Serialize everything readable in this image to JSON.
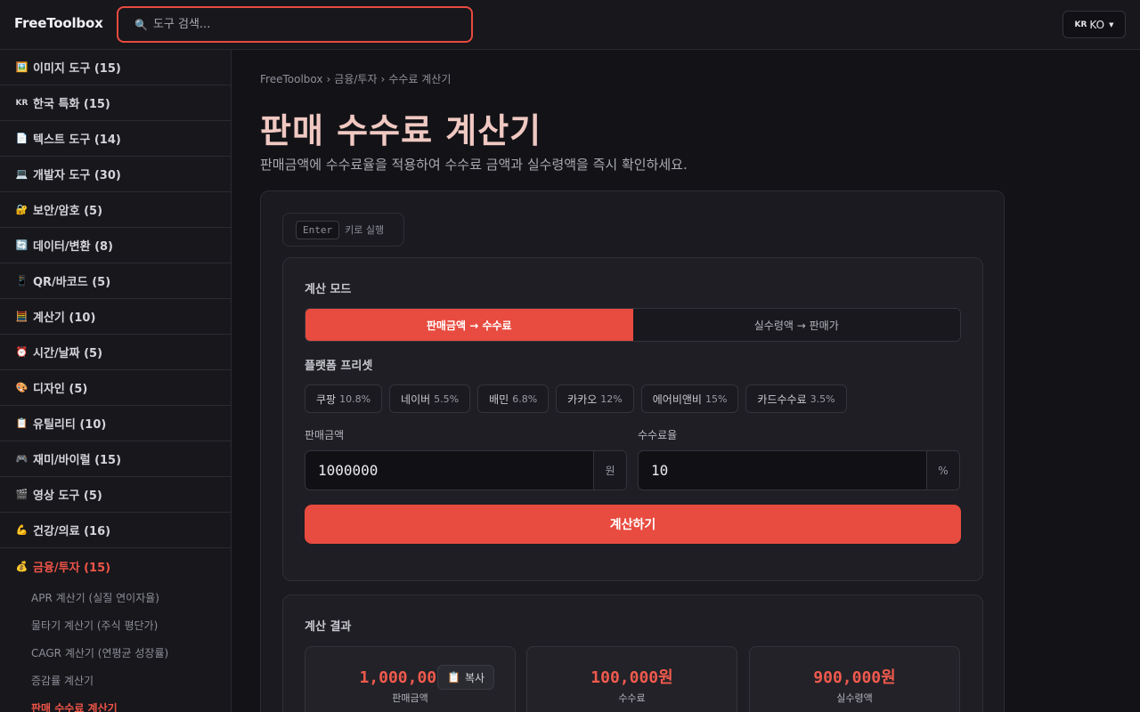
{
  "header": {
    "logo": "FreeToolbox",
    "search_placeholder": "도구 검색...",
    "lang_flag": "KR",
    "lang_label": "KO"
  },
  "sidebar": {
    "categories": [
      {
        "icon": "🖼️",
        "label": "이미지 도구 (15)"
      },
      {
        "icon": "KR",
        "label": "한국 특화 (15)"
      },
      {
        "icon": "📄",
        "label": "텍스트 도구 (14)"
      },
      {
        "icon": "💻",
        "label": "개발자 도구 (30)"
      },
      {
        "icon": "🔐",
        "label": "보안/암호 (5)"
      },
      {
        "icon": "🔄",
        "label": "데이터/변환 (8)"
      },
      {
        "icon": "📱",
        "label": "QR/바코드 (5)"
      },
      {
        "icon": "🧮",
        "label": "계산기 (10)"
      },
      {
        "icon": "⏰",
        "label": "시간/날짜 (5)"
      },
      {
        "icon": "🎨",
        "label": "디자인 (5)"
      },
      {
        "icon": "📋",
        "label": "유틸리티 (10)"
      },
      {
        "icon": "🎮",
        "label": "재미/바이럴 (15)"
      },
      {
        "icon": "🎬",
        "label": "영상 도구 (5)"
      },
      {
        "icon": "💪",
        "label": "건강/의료 (16)"
      },
      {
        "icon": "💰",
        "label": "금융/투자 (15)"
      }
    ],
    "subitems": [
      "APR 계산기 (실질 연이자율)",
      "물타기 계산기 (주식 평단가)",
      "CAGR 계산기 (연평균 성장률)",
      "증감률 계산기",
      "판매 수수료 계산기"
    ]
  },
  "main": {
    "breadcrumb": [
      "FreeToolbox",
      "금융/투자",
      "수수료 계산기"
    ],
    "breadcrumb_sep": "›",
    "title": "판매 수수료 계산기",
    "description": "판매금액에 수수료율을 적용하여 수수료 금액과 실수령액을 즉시 확인하세요.",
    "enter_key": "Enter",
    "enter_hint": "키로 실행",
    "mode_label": "계산 모드",
    "modes": [
      "판매금액 → 수수료",
      "실수령액 → 판매가"
    ],
    "preset_label": "플랫폼 프리셋",
    "presets": [
      {
        "name": "쿠팡",
        "rate": "10.8%"
      },
      {
        "name": "네이버",
        "rate": "5.5%"
      },
      {
        "name": "배민",
        "rate": "6.8%"
      },
      {
        "name": "카카오",
        "rate": "12%"
      },
      {
        "name": "에어비앤비",
        "rate": "15%"
      },
      {
        "name": "카드수수료",
        "rate": "3.5%"
      }
    ],
    "amount_label": "판매금액",
    "amount_value": "1000000",
    "amount_unit": "원",
    "rate_label": "수수료율",
    "rate_value": "10",
    "rate_unit": "%",
    "calc_button": "계산하기",
    "result_label": "계산 결과",
    "results": [
      {
        "value": "1,000,000원",
        "label": "판매금액"
      },
      {
        "value": "100,000원",
        "label": "수수료"
      },
      {
        "value": "900,000원",
        "label": "실수령액"
      }
    ],
    "copy_icon": "📋",
    "copy_label": "복사"
  }
}
